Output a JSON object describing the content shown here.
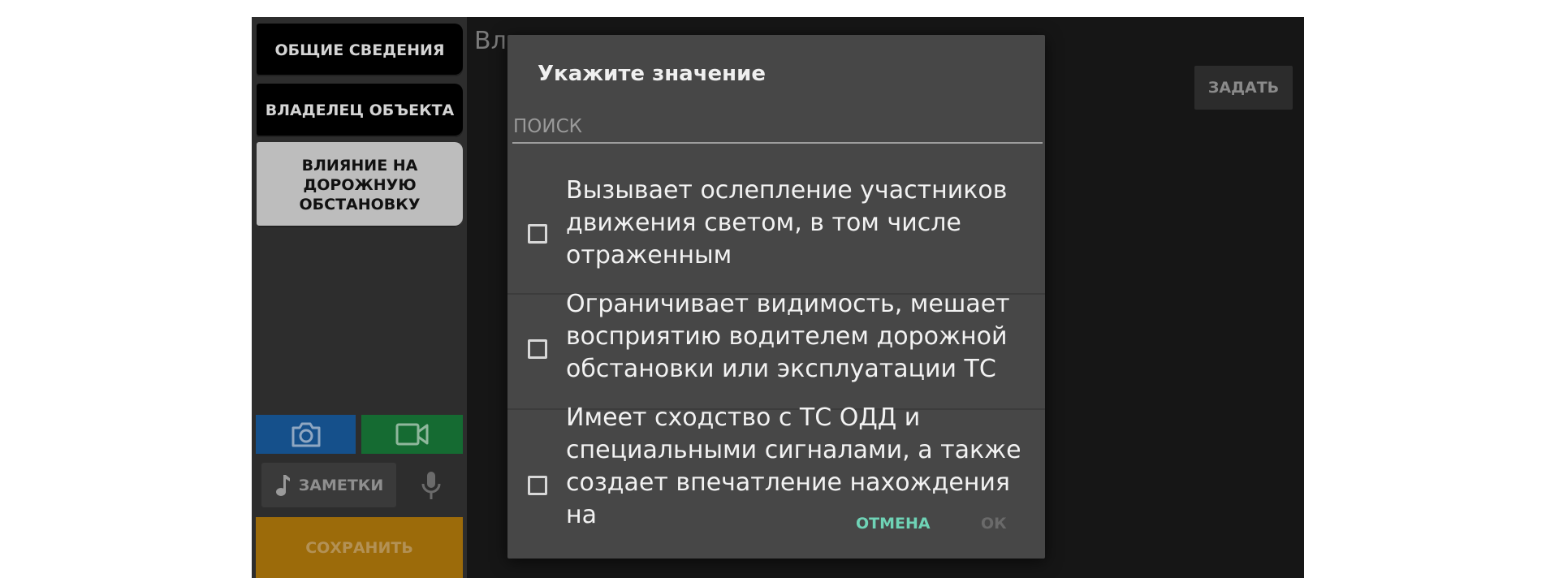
{
  "sidebar": {
    "tabs": [
      {
        "label": "ОБЩИЕ СВЕДЕНИЯ"
      },
      {
        "label": "ВЛАДЕЛЕЦ ОБЪЕКТА"
      },
      {
        "label": "ВЛИЯНИЕ НА\nДОРОЖНУЮ\nОБСТАНОВКУ"
      }
    ],
    "photo_icon": "camera-icon",
    "video_icon": "video-camera-icon",
    "notes_icon": "music-note-icon",
    "notes_label": "ЗАМЕТКИ",
    "mic_icon": "microphone-icon",
    "save_label": "СОХРАНИТЬ"
  },
  "main": {
    "title_partial": "Вл",
    "set_label": "ЗАДАТЬ"
  },
  "dialog": {
    "title": "Укажите значение",
    "search_placeholder": "ПОИСК",
    "options": [
      {
        "text": "Вызывает ослепление участников\nдвижения светом, в том числе\nотраженным",
        "checked": false
      },
      {
        "text": "Ограничивает видимость, мешает\nвосприятию водителем дорожной\nобстановки или эксплуатации ТС",
        "checked": false
      },
      {
        "text": "Имеет сходство с ТС ОДД и\nспециальными сигналами, а также\nсоздает впечатление нахождения на",
        "checked": false
      }
    ],
    "cancel_label": "ОТМЕНА",
    "ok_label": "ОК"
  },
  "colors": {
    "accent": "#6fd3b6",
    "photo": "#15508b",
    "video": "#156b32",
    "save": "#9c6b0a"
  }
}
